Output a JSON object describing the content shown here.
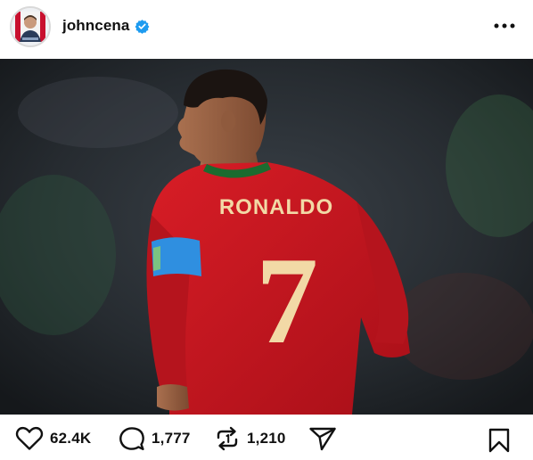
{
  "post": {
    "username": "johncena",
    "verified": true,
    "more_icon": "more-horizontal-icon"
  },
  "media": {
    "jersey_name": "RONALDO",
    "jersey_number": "7",
    "colors": {
      "shirt": "#c8141e",
      "collar": "#1b6b2f",
      "armband": "#2f8fe0",
      "lettering": "#f2d9a6"
    }
  },
  "actions": {
    "likes": "62.4K",
    "comments": "1,777",
    "reposts": "1,210",
    "icons": [
      "heart-icon",
      "comment-icon",
      "repost-icon",
      "send-icon",
      "bookmark-icon"
    ]
  },
  "theme": {
    "verified_blue": "#1d9bf0",
    "text": "#111111"
  }
}
